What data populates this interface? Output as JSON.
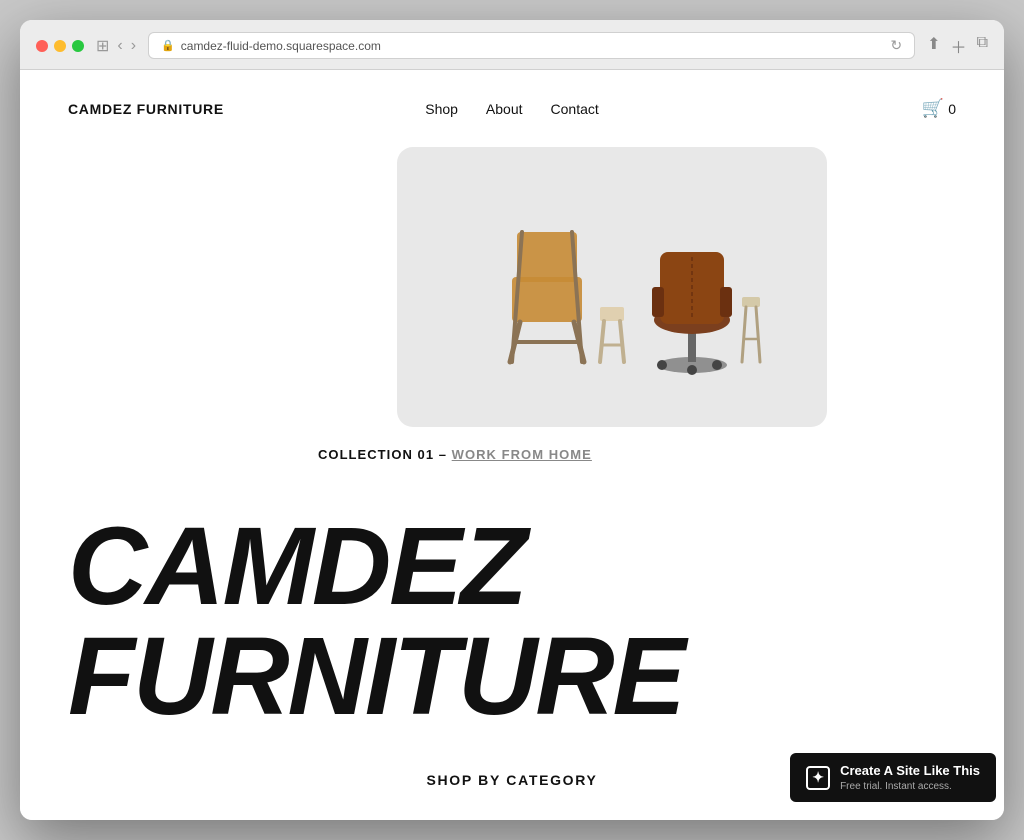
{
  "browser": {
    "url": "camdez-fluid-demo.squarespace.com",
    "reload_icon": "↻"
  },
  "header": {
    "logo": "CAMDEZ FURNITURE",
    "nav": [
      {
        "label": "Shop",
        "id": "shop"
      },
      {
        "label": "About",
        "id": "about"
      },
      {
        "label": "Contact",
        "id": "contact"
      }
    ],
    "cart_count": "0"
  },
  "collection": {
    "label_prefix": "COLLECTION 01 – ",
    "label_link": "WORK FROM HOME"
  },
  "brand_text": "CAMDEZ FURNITURE",
  "shop_by_category_label": "SHOP BY CATEGORY",
  "sq_badge": {
    "title": "Create A Site Like This",
    "subtitle": "Free trial. Instant access."
  }
}
